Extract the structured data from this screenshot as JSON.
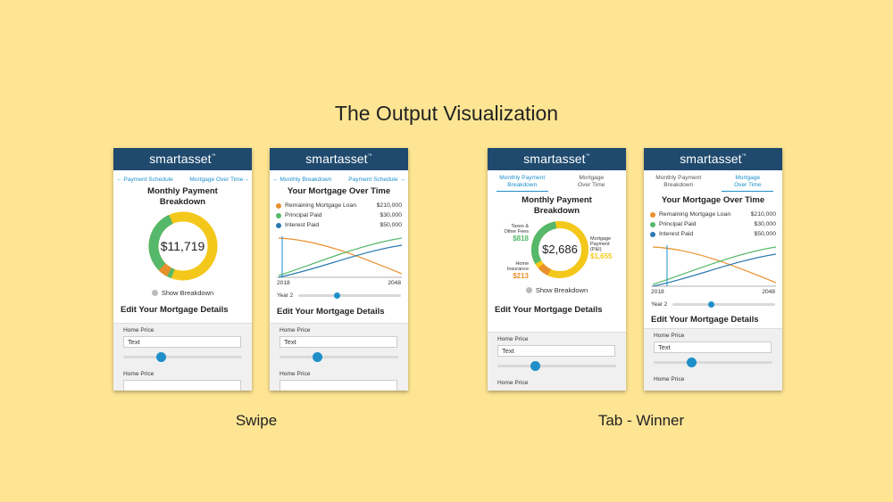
{
  "slide": {
    "title": "The Output Visualization",
    "caption_swipe": "Swipe",
    "caption_tab": "Tab - Winner"
  },
  "brand": {
    "name": "smartasset",
    "tm": "™",
    "header_color": "#1f4a6e"
  },
  "colors": {
    "accent": "#1e8fc9",
    "green": "#55b86a",
    "yellow": "#f4c81a",
    "orange": "#e8902c",
    "blue": "#2a7ab0"
  },
  "nav": {
    "phone1_left": "← Payment Schedule",
    "phone1_right": "Mortgage Over Time→",
    "phone2_left": "← Monthly Breakdown",
    "phone2_right": "Payment Schedule →"
  },
  "tabs": {
    "monthly_line1": "Monthly Payment",
    "monthly_line2": "Breakdown",
    "over_line1": "Mortgage",
    "over_line2": "Over Time"
  },
  "monthly": {
    "title_line1": "Monthly Payment",
    "title_line2": "Breakdown",
    "total_swipe": "$11,719",
    "total_tab": "$2,686",
    "show_breakdown": "Show Breakdown",
    "taxes_label_1": "Taxes &",
    "taxes_label_2": "Other Fees",
    "taxes_amount": "$818",
    "insurance_label_1": "Home",
    "insurance_label_2": "Insurance",
    "insurance_amount": "$213",
    "mortgage_label_1": "Mortgage",
    "mortgage_label_2": "Payment",
    "mortgage_label_3": "(P&I)",
    "mortgage_amount": "$1,655"
  },
  "over_time": {
    "title": "Your Mortgage Over Time",
    "legend": [
      {
        "label": "Remaining Mortgage Loan",
        "value": "$210,000",
        "color": "#e8902c"
      },
      {
        "label": "Principal Paid",
        "value": "$30,000",
        "color": "#55b86a"
      },
      {
        "label": "Interest Paid",
        "value": "$50,000",
        "color": "#2a7ab0"
      }
    ],
    "year_start": "2018",
    "year_end": "2048",
    "year_slider_label": "Year 2"
  },
  "edit": {
    "title": "Edit Your Mortgage Details",
    "home_price_label": "Home Price",
    "home_price_value": "Text"
  }
}
